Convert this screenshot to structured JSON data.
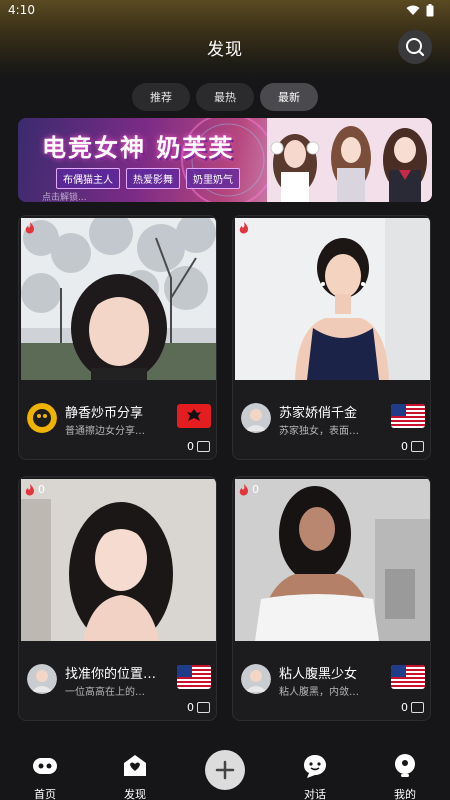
{
  "status_bar": {
    "time": "4:10"
  },
  "header": {
    "title": "发现"
  },
  "tabs": [
    {
      "label": "推荐",
      "active": false
    },
    {
      "label": "最热",
      "active": false
    },
    {
      "label": "最新",
      "active": true
    }
  ],
  "banner": {
    "title": "电竞女神 奶芙芙",
    "tags": [
      "布偶猫主人",
      "热爱影舞",
      "奶里奶气"
    ],
    "subtitle": "点击解锁..."
  },
  "cards": [
    {
      "name": "静香炒币分享",
      "desc": "普通擦边女分享…",
      "hot": "",
      "count": "0",
      "flag": "albania"
    },
    {
      "name": "苏家娇俏千金",
      "desc": "苏家独女，表面…",
      "hot": "",
      "count": "0",
      "flag": "usa"
    },
    {
      "name": "找准你的位置…",
      "desc": "一位高高在上的…",
      "hot": "0",
      "count": "0",
      "flag": "usa"
    },
    {
      "name": "粘人腹黑少女",
      "desc": "粘人腹黑，内敛…",
      "hot": "0",
      "count": "0",
      "flag": "usa"
    }
  ],
  "nav": [
    {
      "label": "首页",
      "icon": "home-icon"
    },
    {
      "label": "发现",
      "icon": "discover-icon"
    },
    {
      "label": "",
      "icon": "plus-icon"
    },
    {
      "label": "对话",
      "icon": "chat-icon"
    },
    {
      "label": "我的",
      "icon": "profile-icon"
    }
  ],
  "colors": {
    "background": "#161618",
    "card": "#1c1c1f",
    "tab": "#2b2b2e",
    "tab_active": "#4a4a4e"
  }
}
